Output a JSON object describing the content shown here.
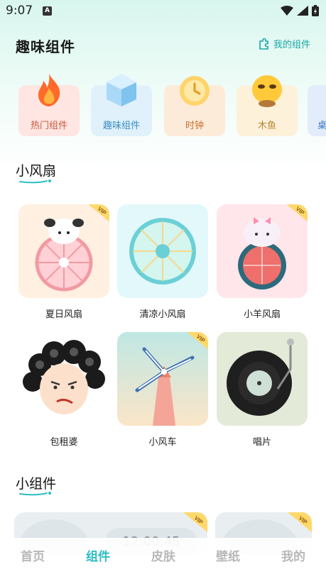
{
  "status": {
    "time": "9:07",
    "notif": "A"
  },
  "header": {
    "title": "趣味组件",
    "my_widgets": "我的组件"
  },
  "categories": [
    {
      "label": "热门组件",
      "icon": "flame-icon"
    },
    {
      "label": "趣味组件",
      "icon": "crystal-cube-icon"
    },
    {
      "label": "时钟",
      "icon": "clock-icon"
    },
    {
      "label": "木鱼",
      "icon": "wooden-fish-icon"
    },
    {
      "label": "桌",
      "icon": "desk-icon"
    }
  ],
  "section_fan": {
    "title": "小风扇",
    "items": [
      {
        "label": "夏日风扇",
        "vip": "VIP"
      },
      {
        "label": "清凉小风扇",
        "vip": ""
      },
      {
        "label": "小羊风扇",
        "vip": "VIP"
      },
      {
        "label": "包租婆",
        "vip": ""
      },
      {
        "label": "小风车",
        "vip": "VIP"
      },
      {
        "label": "唱片",
        "vip": ""
      }
    ]
  },
  "section_widget": {
    "title": "小组件",
    "preview_time": "12:00:45",
    "vip": "VIP"
  },
  "tabs": [
    {
      "label": "首页",
      "active": false
    },
    {
      "label": "组件",
      "active": true
    },
    {
      "label": "皮肤",
      "active": false
    },
    {
      "label": "壁纸",
      "active": false
    },
    {
      "label": "我的",
      "active": false
    }
  ],
  "colors": {
    "accent": "#2dbec2",
    "teal_text": "#1aa6a8",
    "inactive_tab": "#b8b8b8"
  }
}
